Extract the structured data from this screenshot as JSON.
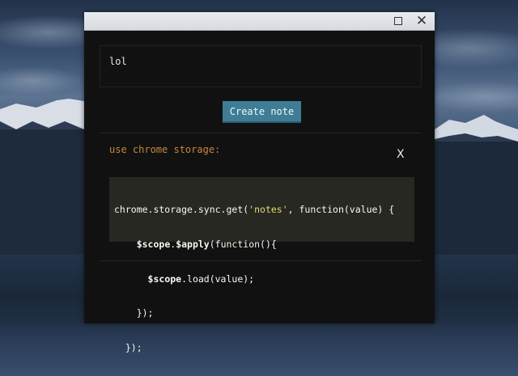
{
  "window": {
    "maximize_icon": "maximize-icon",
    "close_icon": "close-icon",
    "close_label": "✕"
  },
  "editor": {
    "value": "lol"
  },
  "actions": {
    "create_note_label": "Create note"
  },
  "notes": [
    {
      "text": "use chrome storage:",
      "delete_label": "X",
      "code_lines": [
        [
          "chrome.storage.sync.get(",
          "'notes'",
          ", function(value) {"
        ],
        [
          "    ",
          "$scope",
          ".",
          "$apply",
          "(function(){"
        ],
        [
          "      ",
          "$scope",
          ".load(value);"
        ],
        [
          "    });"
        ],
        [
          "  });"
        ]
      ]
    }
  ],
  "colors": {
    "accent": "#3f7d96",
    "note_text": "#c6873e",
    "code_bg": "#272822",
    "code_string": "#e6db74",
    "window_bg": "#111111"
  }
}
